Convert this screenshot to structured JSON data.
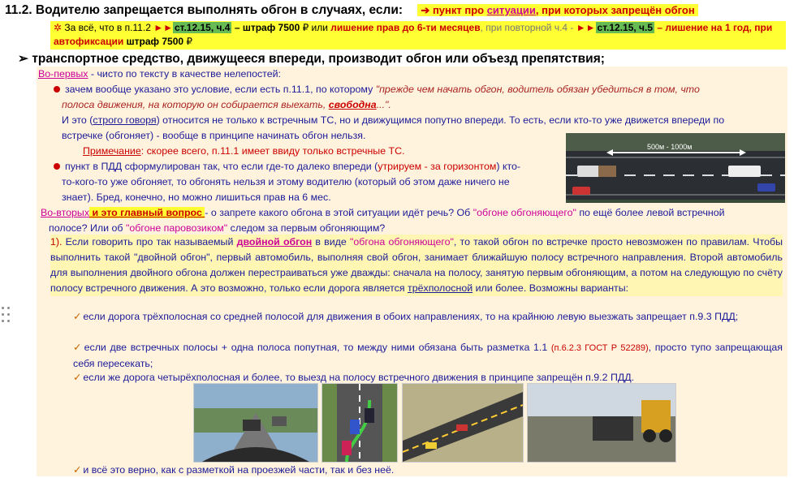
{
  "heading": {
    "title": "11.2. Водителю запрещается выполнять обгон в случаях, если:",
    "arrow": "➔",
    "pointer_pre": " пункт про ",
    "pointer_link": "ситуации",
    "pointer_post": ", при которых запрещён обгон"
  },
  "penalty": {
    "star": "✲",
    "t1": " За всё, что в п.11.2 ",
    "tri1": "►►",
    "code1": "ст.12.15, ч.4",
    "t2": " – штраф 7500 ",
    "rub1": "₽",
    "t3": " или ",
    "t4": "лишение прав до 6-ти месяцев",
    "t5": ", при повторной ч.4 - ",
    "tri2": "►►",
    "code2": "ст.12.15, ч.5",
    "t6": " – лишение на 1 год, при",
    "t7": "автофиксации",
    "t8": " штраф 7500 ",
    "rub2": "₽"
  },
  "subheading": {
    "marker": "➢",
    "text": "транспортное средство, движущееся впереди, производит обгон или объезд препятствия;"
  },
  "first": {
    "label": "Во-первых",
    "text": " - чисто по тексту в качестве нелепостей:",
    "b1_line1_a": "зачем вообще указано это условие, если есть п.11.1, по которому ",
    "b1_line1_q": "\"прежде чем начать обгон, водитель обязан убедиться в том, что",
    "b1_line2_q": "полоса движения,  на которую он собирается выехать, ",
    "b1_free": "свободна",
    "b1_line2_end": "...\".",
    "b1_line3_a": "И это (",
    "b1_strict": "строго говоря",
    "b1_line3_b": ") относится не только к встречным ТС, но и движущимся попутно впереди. То есть, если кто-то уже движется впереди по",
    "b1_line4": "встречке (обгоняет) - вообще в принципе начинать обгон нельзя.",
    "note_label": "Примечание",
    "note_text": ": скорее всего, п.11.1 имеет ввиду только встречные ТС.",
    "b2_line1_a": "пункт в ПДД сформулирован так, что если где-то далеко впереди (",
    "b2_paren": "утрируем - за горизонтом",
    "b2_line1_b": ") кто-",
    "b2_line2": "то-кого-то уже обгоняет, то обгонять нельзя и этому водителю (который об этом даже ничего не",
    "b2_line3": "знает). Бред, конечно, но можно лишиться прав на 6 мес.",
    "road_label": "500м - 1000м"
  },
  "second": {
    "label": "Во-вторых",
    "hl": " и это главный вопрос ",
    "t1": " - о запрете какого обгона в этой ситуации идёт речь? Об ",
    "q1": "\"обгоне обгоняющего\"",
    "t2": " по ещё более левой встречной",
    "t3": "полосе? Или об ",
    "q2": "\"обгоне паровозиком\"",
    "t4": " следом за первым обгоняющим?"
  },
  "point1": {
    "num": "1).",
    "a": " Если говорить про так называемый ",
    "double": "двойной обгон",
    "b": " в виде ",
    "q": "\"обгона обгоняющего\"",
    "c": ", то такой обгон по встречке просто невозможен по правилам. Чтобы выполнить такой \"двойной обгон\", первый автомобиль, выполняя свой обгон, занимает ближайшую полосу встречного направления. Второй автомобиль для выполнения двойного обгона должен перестраиваться уже дважды: сначала на полосу, занятую первым обгоняющим, а потом на следующую по счёту полосу встречного движения. А это возможно, только если дорога является ",
    "three": "трёхполосной",
    "d": " или более. Возможны варианты:"
  },
  "variants": {
    "v1": "если дорога трёхполосная со средней полосой для движения в обоих направлениях, то на крайнюю левую выезжать запрещает п.9.3 ПДД;",
    "v2_a": "если две встречных полосы + одна полоса попутная, то между ними обязана быть разметка 1.1 ",
    "v2_ref": "(п.6.2.3 ГОСТ Р 52289)",
    "v2_b": ", просто тупо запрещающая себя пересекать;",
    "v3": "если же дорога четырёхполосная и более, то выезд на полосу встречного движения в принципе запрещён п.9.2 ПДД.",
    "v4": "и всё это верно, как с разметкой на проезжей части, так и без неё."
  },
  "icons": {
    "check": "✓"
  },
  "colors": {
    "yellow": "#ffff33",
    "panel": "#fff3dd",
    "text": "#1a1a99",
    "red": "#cc0000",
    "pink": "#cc0099"
  }
}
